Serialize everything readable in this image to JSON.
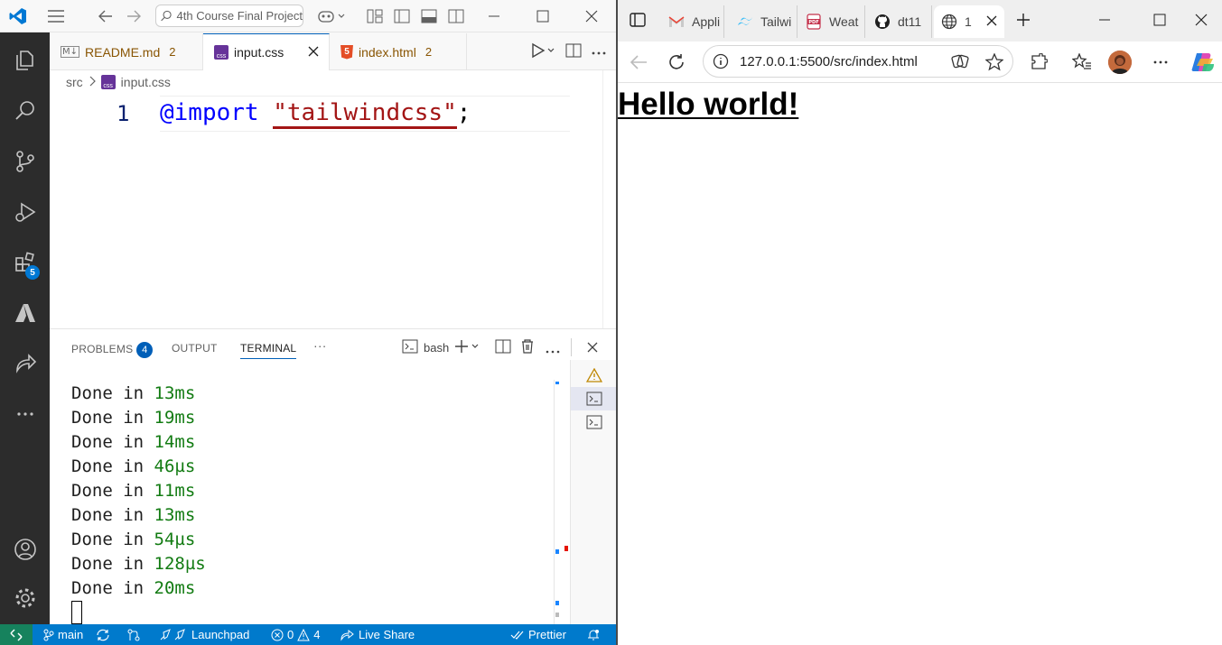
{
  "vscode": {
    "search_text": "4th Course Final Project",
    "tabs": [
      {
        "icon": "M↓",
        "label": "README.md",
        "count": "2"
      },
      {
        "icon": "css",
        "label": "input.css",
        "count": ""
      },
      {
        "icon": "5",
        "label": "index.html",
        "count": "2"
      }
    ],
    "breadcrumb": {
      "folder": "src",
      "file": "input.css"
    },
    "editor": {
      "line_number": "1",
      "keyword": "@import",
      "string": "\"tailwindcss\"",
      "punct": ";"
    },
    "activity_badge": "5",
    "panel": {
      "problems_label": "PROBLEMS",
      "problems_count": "4",
      "output_label": "OUTPUT",
      "terminal_label": "TERMINAL",
      "more": "···",
      "shell_label": "bash"
    },
    "terminal_lines": [
      {
        "prefix": "Done in ",
        "time": "13ms"
      },
      {
        "prefix": "Done in ",
        "time": "19ms"
      },
      {
        "prefix": "Done in ",
        "time": "14ms"
      },
      {
        "prefix": "Done in ",
        "time": "46µs"
      },
      {
        "prefix": "Done in ",
        "time": "11ms"
      },
      {
        "prefix": "Done in ",
        "time": "13ms"
      },
      {
        "prefix": "Done in ",
        "time": "54µs"
      },
      {
        "prefix": "Done in ",
        "time": "128µs"
      },
      {
        "prefix": "Done in ",
        "time": "20ms"
      }
    ],
    "statusbar": {
      "branch": "main",
      "launchpad": "Launchpad",
      "errors": "0",
      "warnings": "4",
      "live_share": "Live Share",
      "prettier": "Prettier"
    },
    "colors": {
      "accent": "#007acc",
      "activity_bar": "#2c2c2c",
      "remote": "#16825d",
      "terminal_time": "#127b12"
    }
  },
  "browser": {
    "tabs": [
      {
        "label": "Appli",
        "icon": "gmail-icon"
      },
      {
        "label": "Tailwi",
        "icon": "tailwind-icon"
      },
      {
        "label": "Weat",
        "icon": "pdf-icon"
      },
      {
        "label": "dt11",
        "icon": "github-icon"
      },
      {
        "label": "1",
        "icon": "globe-icon"
      }
    ],
    "url": "127.0.0.1:5500/src/index.html",
    "page_heading": "Hello world!"
  }
}
